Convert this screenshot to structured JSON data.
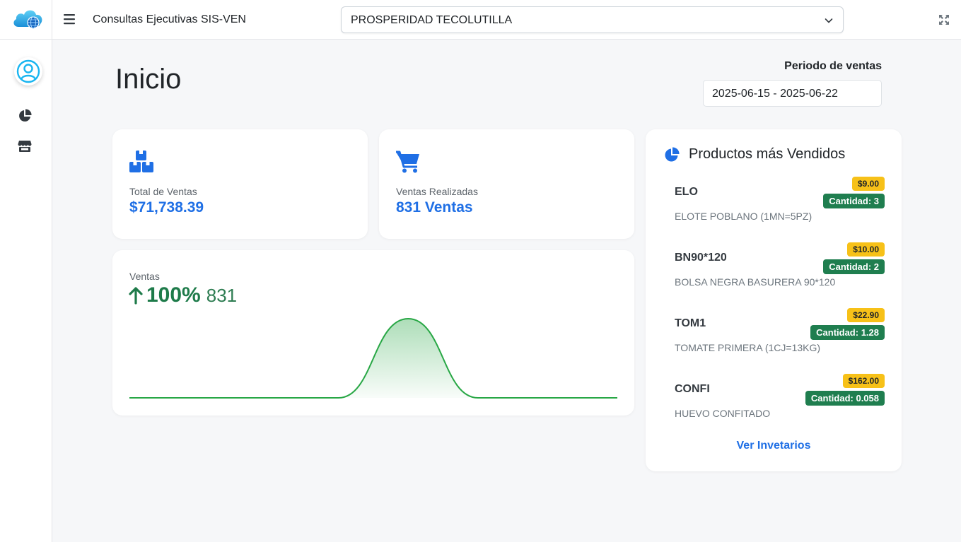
{
  "topbar": {
    "app_title": "Consultas Ejecutivas SIS-VEN",
    "store_selected": "PROSPERIDAD TECOLUTILLA"
  },
  "page": {
    "title": "Inicio",
    "period_label": "Periodo de ventas",
    "period_value": "2025-06-15 - 2025-06-22"
  },
  "stats": {
    "total_label": "Total de Ventas",
    "total_value": "$71,738.39",
    "count_label": "Ventas Realizadas",
    "count_value": "831 Ventas"
  },
  "sales_chart": {
    "label": "Ventas",
    "change_pct": "100%",
    "count": "831"
  },
  "chart_data": {
    "type": "area",
    "x": [
      0,
      1,
      2,
      3,
      4,
      5,
      6,
      7
    ],
    "values": [
      0,
      0,
      0,
      0,
      831,
      0,
      0,
      0
    ],
    "ylim": [
      0,
      831
    ],
    "grid": false,
    "line_color": "#28a745",
    "fill_color": "#28a745"
  },
  "products": {
    "title": "Productos más Vendidos",
    "items": [
      {
        "code": "ELO",
        "price": "$9.00",
        "qty": "Cantidad: 3",
        "desc": "ELOTE POBLANO (1MN=5PZ)"
      },
      {
        "code": "BN90*120",
        "price": "$10.00",
        "qty": "Cantidad: 2",
        "desc": "BOLSA NEGRA BASURERA 90*120"
      },
      {
        "code": "TOM1",
        "price": "$22.90",
        "qty": "Cantidad: 1.28",
        "desc": "TOMATE PRIMERA (1CJ=13KG)"
      },
      {
        "code": "CONFI",
        "price": "$162.00",
        "qty": "Cantidad: 0.058",
        "desc": "HUEVO CONFITADO"
      }
    ],
    "link": "Ver Invetarios"
  },
  "colors": {
    "primary": "#1f6fe5",
    "success": "#1f7e4f",
    "warning": "#f7c118",
    "chart_line": "#28a745"
  },
  "icons": {
    "logo": "cloud-globe-icon",
    "avatar": "user-circle-icon",
    "nav_1": "pie-chart-icon",
    "nav_2": "store-icon",
    "menu": "hamburger-icon",
    "select": "chevron-down-icon",
    "fullscreen": "expand-icon",
    "total": "boxes-icon",
    "count": "cart-icon",
    "trend": "arrow-up-icon"
  }
}
